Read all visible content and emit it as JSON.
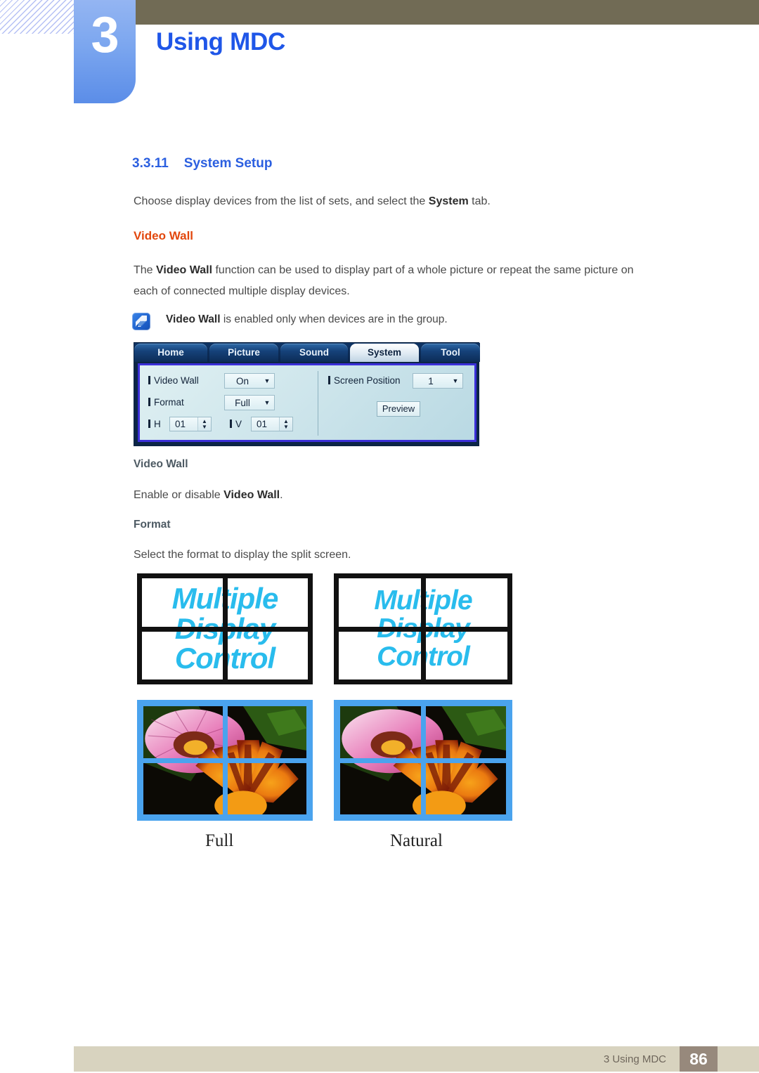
{
  "chapter": {
    "number": "3",
    "title": "Using MDC"
  },
  "section": {
    "number": "3.3.11",
    "title": "System Setup",
    "intro_before": "Choose display devices from the list of sets, and select the ",
    "intro_bold": "System",
    "intro_after": " tab."
  },
  "video_wall": {
    "heading": "Video Wall",
    "paragraph_1_before": "The ",
    "paragraph_1_bold": "Video Wall",
    "paragraph_1_after": " function can be used to display part of a whole picture or repeat the same picture on",
    "paragraph_2": "each of connected multiple display devices.",
    "note_bold": "Video Wall",
    "note_rest": " is enabled only when devices are in the group.",
    "note_icon": "note-pen-icon"
  },
  "mdc_dialog": {
    "tabs": [
      {
        "label": "Home",
        "active": false
      },
      {
        "label": "Picture",
        "active": false
      },
      {
        "label": "Sound",
        "active": false
      },
      {
        "label": "System",
        "active": true
      },
      {
        "label": "Tool",
        "active": false
      }
    ],
    "fields": {
      "video_wall_label": "Video Wall",
      "video_wall_value": "On",
      "format_label": "Format",
      "format_value": "Full",
      "h_label": "H",
      "h_value": "01",
      "v_label": "V",
      "v_value": "01",
      "screen_position_label": "Screen Position",
      "screen_position_value": "1",
      "preview_label": "Preview"
    }
  },
  "descriptions": {
    "video_wall_heading": "Video Wall",
    "video_wall_text_before": "Enable or disable ",
    "video_wall_text_bold": "Video Wall",
    "video_wall_text_after": ".",
    "format_heading": "Format",
    "format_text": "Select the format to display the split screen."
  },
  "format_examples": {
    "screen_text_line1": "Multiple",
    "screen_text_line2": "Display",
    "screen_text_line3": "Control",
    "caption_full": "Full",
    "caption_natural": "Natural"
  },
  "footer": {
    "label": "3 Using MDC",
    "page": "86"
  },
  "colors": {
    "chapter_blue": "#1f56e8",
    "header_brown": "#716b55",
    "tab_blue": "#7ba6ef",
    "section_blue": "#2b5fe0",
    "orange_heading": "#e2470d",
    "slate_heading": "#4d5a63",
    "body_gray": "#4a4a4a",
    "screen_text_cyan": "#29bced",
    "bezel_blue": "#4aa3ee",
    "footer_beige": "#d8d3bf",
    "page_box_brown": "#97897c"
  }
}
